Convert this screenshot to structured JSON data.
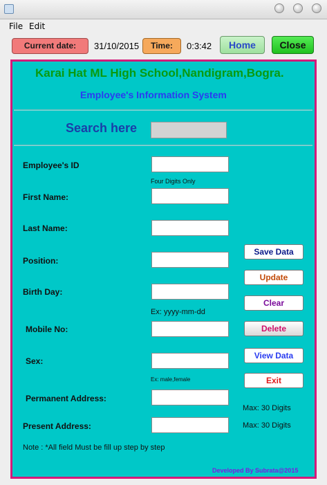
{
  "window": {
    "title": ""
  },
  "menu": {
    "file": "File",
    "edit": "Edit"
  },
  "toolbar": {
    "date_label": "Current date:",
    "date_value": "31/10/2015",
    "time_label": "Time:",
    "time_value": "0:3:42",
    "home": "Home",
    "close": "Close"
  },
  "header": {
    "school": "Karai Hat ML High School,Nandigram,Bogra.",
    "system": "Employee's Information System"
  },
  "search": {
    "label": "Search here",
    "value": ""
  },
  "fields": {
    "employee_id": {
      "label": "Employee's ID",
      "value": "",
      "hint": "Four Digits Only"
    },
    "first_name": {
      "label": "First Name:",
      "value": ""
    },
    "last_name": {
      "label": "Last Name:",
      "value": ""
    },
    "position": {
      "label": "Position:",
      "value": ""
    },
    "birth_day": {
      "label": "Birth Day:",
      "value": "",
      "hint": "Ex: yyyy-mm-dd"
    },
    "mobile": {
      "label": "Mobile No:",
      "value": ""
    },
    "sex": {
      "label": "Sex:",
      "value": "",
      "hint": "Ex: male,female"
    },
    "permanent_address": {
      "label": "Permanent Address:",
      "value": "",
      "hint": "Max: 30 Digits"
    },
    "present_address": {
      "label": "Present Address:",
      "value": "",
      "hint": "Max: 30 Digits"
    }
  },
  "actions": {
    "save": "Save Data",
    "update": "Update",
    "clear": "Clear",
    "delete": "Delete",
    "view": "View Data",
    "exit": "Exit"
  },
  "footer": {
    "note": "Note : *All field Must be fill up step by step",
    "credit": "Developed By Subrata@2015"
  },
  "colors": {
    "panel_bg": "#00c8c8",
    "panel_border": "#d4197a",
    "school_title": "#0a9a10",
    "system_title": "#2a3cf0",
    "search_title": "#1a3ea8",
    "date_label_bg": "#f17a7a",
    "time_label_bg": "#f6a95b",
    "home_bg": "#9fe09f",
    "close_bg": "#1fc21f",
    "save_text": "#0b1a8a",
    "update_text": "#c24a08",
    "clear_text": "#7a0a9a",
    "delete_text": "#d0106a",
    "view_text": "#2a3cf0",
    "exit_text": "#e01a1a",
    "credit_text": "#7a1ee0"
  }
}
